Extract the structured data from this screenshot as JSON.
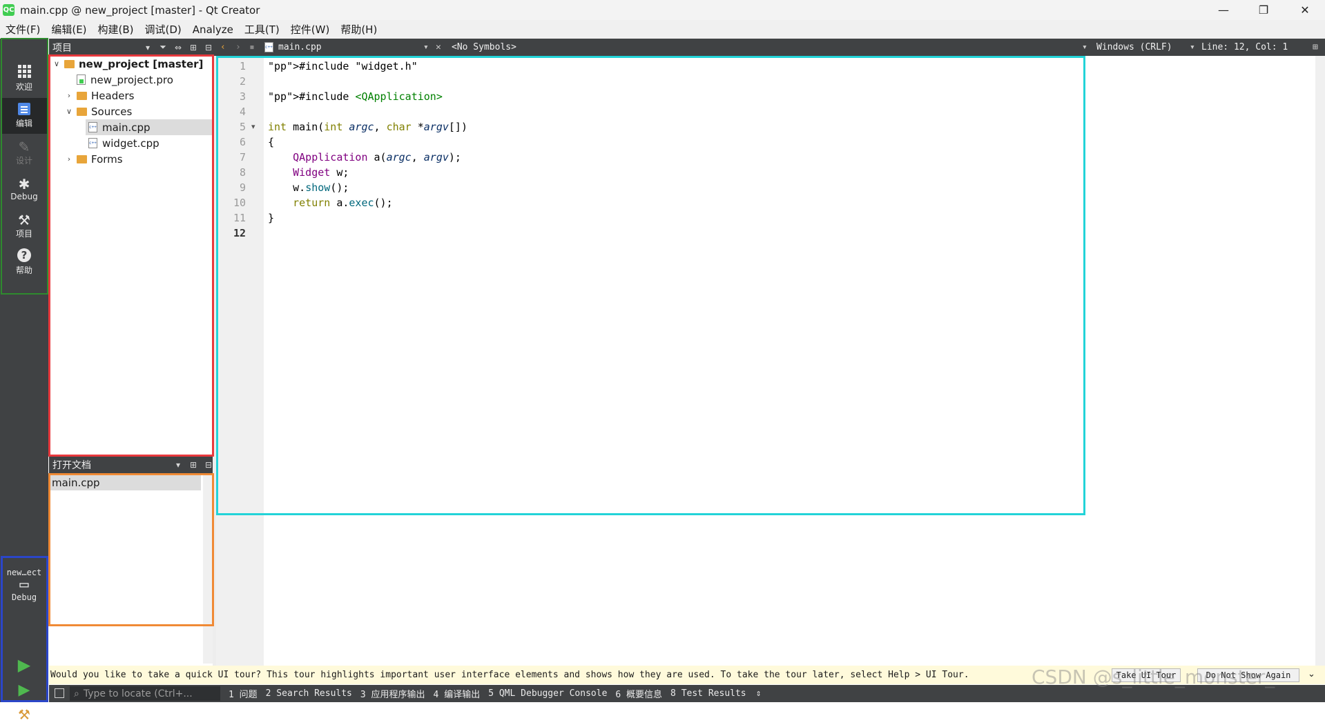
{
  "window": {
    "title": "main.cpp @ new_project [master] - Qt Creator",
    "app_icon": "QC",
    "minimize": "—",
    "maximize": "❐",
    "close": "✕"
  },
  "menu": [
    "文件(F)",
    "编辑(E)",
    "构建(B)",
    "调试(D)",
    "Analyze",
    "工具(T)",
    "控件(W)",
    "帮助(H)"
  ],
  "modes": [
    {
      "label": "欢迎",
      "icon": "grid-icon"
    },
    {
      "label": "编辑",
      "icon": "edit-document-icon"
    },
    {
      "label": "设计",
      "icon": "pencil-icon"
    },
    {
      "label": "Debug",
      "icon": "bug-icon"
    },
    {
      "label": "项目",
      "icon": "wrench-icon"
    },
    {
      "label": "帮助",
      "icon": "help-icon"
    }
  ],
  "kit": {
    "project": "new…ect",
    "config": "Debug"
  },
  "project_panel": {
    "title": "项目",
    "tree": [
      {
        "label": "new_project [master]",
        "type": "project",
        "expanded": true
      },
      {
        "label": "new_project.pro",
        "type": "pro"
      },
      {
        "label": "Headers",
        "type": "folder",
        "expanded": false
      },
      {
        "label": "Sources",
        "type": "folder",
        "expanded": true
      },
      {
        "label": "main.cpp",
        "type": "cpp",
        "selected": true
      },
      {
        "label": "widget.cpp",
        "type": "cpp"
      },
      {
        "label": "Forms",
        "type": "folder",
        "expanded": false
      }
    ]
  },
  "open_docs": {
    "title": "打开文档",
    "items": [
      "main.cpp"
    ]
  },
  "editor_toolbar": {
    "file": "main.cpp",
    "symbols": "<No Symbols>",
    "line_ending": "Windows (CRLF)",
    "position": "Line: 12, Col: 1"
  },
  "code": {
    "line_numbers": [
      "1",
      "2",
      "3",
      "4",
      "5",
      "6",
      "7",
      "8",
      "9",
      "10",
      "11",
      "12"
    ],
    "current_line": "12",
    "lines": [
      "#include \"widget.h\"",
      "",
      "#include <QApplication>",
      "",
      "int main(int argc, char *argv[])",
      "{",
      "    QApplication a(argc, argv);",
      "    Widget w;",
      "    w.show();",
      "    return a.exec();",
      "}",
      ""
    ]
  },
  "tour": {
    "message": "Would you like to take a quick UI tour? This tour highlights important user interface elements and shows how they are used. To take the tour later, select Help > UI Tour.",
    "take_label": "Take UI Tour",
    "dismiss_label": "Do Not Show Again"
  },
  "status": {
    "locator_placeholder": "Type to locate (Ctrl+...",
    "panes": [
      "1 问题",
      "2 Search Results",
      "3 应用程序输出",
      "4 编译输出",
      "5 QML Debugger Console",
      "6 概要信息",
      "8 Test Results"
    ]
  },
  "watermark": "CSDN @s_little_monster_",
  "annotation_colors": {
    "green": "#2e8b2e",
    "red": "#e8383d",
    "orange": "#f08a35",
    "blue": "#2b46c9",
    "cyan": "#22d3d8"
  }
}
